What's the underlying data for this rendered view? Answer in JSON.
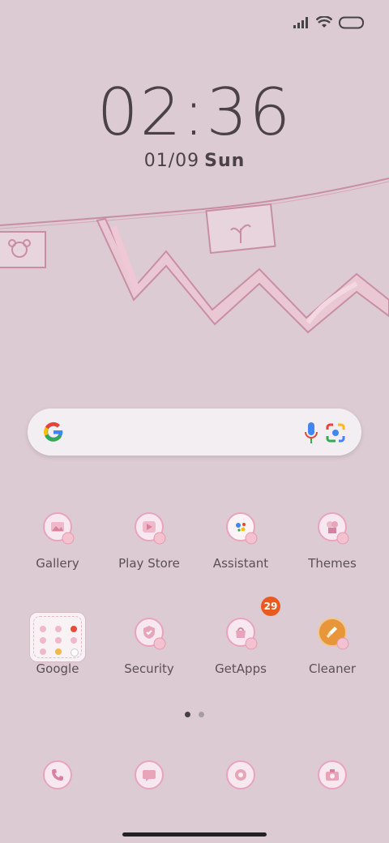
{
  "status_bar": {
    "signal": "signal-icon",
    "wifi": "wifi-icon",
    "battery": "battery-icon"
  },
  "lock": {
    "time": "02:36",
    "date": "01/09",
    "day": "Sun"
  },
  "search": {
    "logo": "google-logo-icon",
    "mic": "mic-icon",
    "lens": "lens-icon"
  },
  "apps_row1": [
    {
      "label": "Gallery",
      "icon": "gallery-icon"
    },
    {
      "label": "Play Store",
      "icon": "play-store-icon"
    },
    {
      "label": "Assistant",
      "icon": "assistant-icon"
    },
    {
      "label": "Themes",
      "icon": "themes-icon"
    }
  ],
  "apps_row2": [
    {
      "label": "Google",
      "icon": "google-folder-icon"
    },
    {
      "label": "Security",
      "icon": "security-icon"
    },
    {
      "label": "GetApps",
      "icon": "getapps-icon",
      "badge": "29"
    },
    {
      "label": "Cleaner",
      "icon": "cleaner-icon"
    }
  ],
  "dock": [
    {
      "icon": "phone-icon"
    },
    {
      "icon": "messages-icon"
    },
    {
      "icon": "browser-icon"
    },
    {
      "icon": "camera-icon"
    }
  ],
  "colors": {
    "background": "#dccbd2",
    "accent_pink": "#e9a4bb",
    "badge": "#ea5a1f",
    "cleaner": "#e7963a"
  }
}
